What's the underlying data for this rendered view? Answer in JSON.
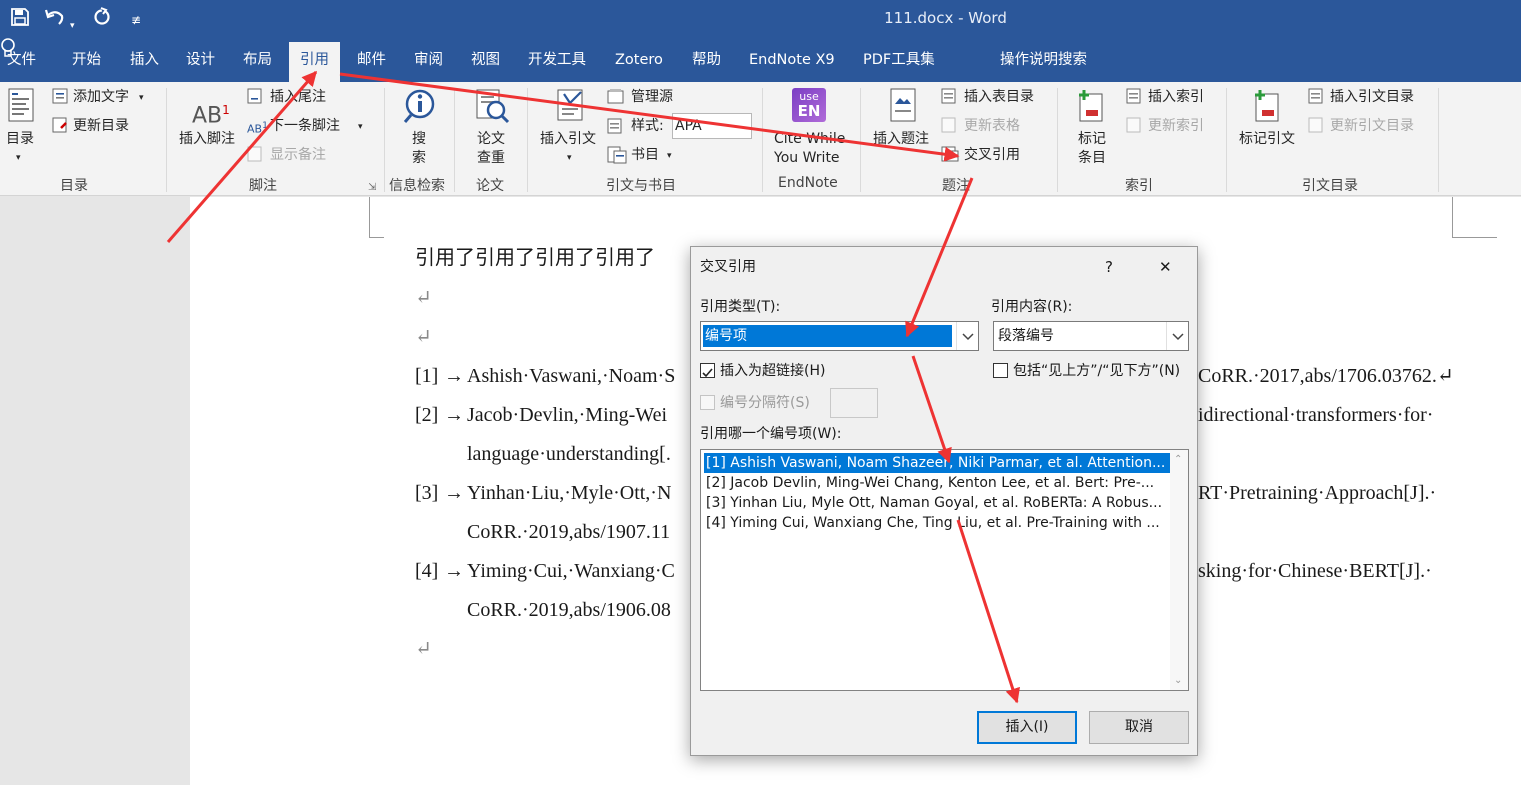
{
  "window": {
    "title": "111.docx  -  Word",
    "accent": "#2b579a",
    "arrow_color": "#ee3333"
  },
  "quick_access": {
    "save_icon": "save-icon",
    "undo_icon": "undo-icon",
    "redo_icon": "redo-icon",
    "customize": "≢"
  },
  "tabs": [
    {
      "label": "文件"
    },
    {
      "label": "开始"
    },
    {
      "label": "插入"
    },
    {
      "label": "设计"
    },
    {
      "label": "布局"
    },
    {
      "label": "引用",
      "active": true
    },
    {
      "label": "邮件"
    },
    {
      "label": "审阅"
    },
    {
      "label": "视图"
    },
    {
      "label": "开发工具"
    },
    {
      "label": "Zotero"
    },
    {
      "label": "帮助"
    },
    {
      "label": "EndNote X9"
    },
    {
      "label": "PDF工具集"
    }
  ],
  "tell_me": "操作说明搜索",
  "ribbon": {
    "toc": {
      "button": "目录",
      "add_text": "添加文字",
      "update": "更新目录",
      "group": "目录"
    },
    "footnotes": {
      "insert_footnote": "插入脚注",
      "insert_endnote": "插入尾注",
      "next_footnote": "下一条脚注",
      "show_notes": "显示备注",
      "group": "脚注",
      "ab_label": "AB",
      "ab_sup": "1"
    },
    "research": {
      "search_line1": "搜",
      "search_line2": "索",
      "group": "信息检索"
    },
    "thesis": {
      "check_line1": "论文",
      "check_line2": "查重",
      "group": "论文"
    },
    "citations": {
      "insert_citation": "插入引文",
      "manage_sources": "管理源",
      "style_label": "样式:",
      "style_value": "APA",
      "bibliography": "书目",
      "group": "引文与书目"
    },
    "endnote": {
      "logo_top": "use",
      "logo_bottom": "EN",
      "cite_line1": "Cite While",
      "cite_line2": "You Write",
      "group": "EndNote"
    },
    "captions": {
      "insert_caption": "插入题注",
      "insert_table_of_figures": "插入表目录",
      "update_table": "更新表格",
      "cross_reference": "交叉引用",
      "group": "题注"
    },
    "index": {
      "mark_entry_line1": "标记",
      "mark_entry_line2": "条目",
      "insert_index": "插入索引",
      "update_index": "更新索引",
      "group": "索引"
    },
    "toa": {
      "mark_citation": "标记引文",
      "insert_toa": "插入引文目录",
      "update_toa": "更新引文目录",
      "group": "引文目录"
    }
  },
  "document": {
    "first_line": "引用了引用了引用了引用了",
    "pilcrow": "↵",
    "refs": [
      {
        "num": "[1]",
        "arrow": "→",
        "left": "Ashish·Vaswani,·Noam·S",
        "right": "CoRR.·2017,abs/1706.03762.↵"
      },
      {
        "num": "[2]",
        "arrow": "→",
        "left": "Jacob·Devlin,·Ming-Wei",
        "right": "idirectional·transformers·for·",
        "cont": "language·understanding[."
      },
      {
        "num": "[3]",
        "arrow": "→",
        "left": "Yinhan·Liu,·Myle·Ott,·N",
        "right": "RT·Pretraining·Approach[J].·",
        "cont": "CoRR.·2019,abs/1907.11"
      },
      {
        "num": "[4]",
        "arrow": "→",
        "left": "Yiming·Cui,·Wanxiang·C",
        "right": "sking·for·Chinese·BERT[J].·",
        "cont": "CoRR.·2019,abs/1906.08"
      }
    ]
  },
  "dialog": {
    "title": "交叉引用",
    "help": "?",
    "close": "✕",
    "ref_type_label": "引用类型(T):",
    "ref_type_value": "编号项",
    "ref_content_label": "引用内容(R):",
    "ref_content_value": "段落编号",
    "insert_hyperlink": "插入为超链接(H)",
    "insert_hyperlink_checked": true,
    "include_above_below": "包括“见上方”/“见下方”(N)",
    "include_above_below_checked": false,
    "separate_numbers": "编号分隔符(S)",
    "for_which_label": "引用哪一个编号项(W):",
    "items": [
      "[1] Ashish Vaswani, Noam Shazeer, Niki Parmar, et al. Attention...",
      "[2] Jacob Devlin, Ming-Wei Chang, Kenton Lee, et al. Bert: Pre-...",
      "[3] Yinhan Liu, Myle Ott, Naman Goyal, et al. RoBERTa: A Robus...",
      "[4] Yiming Cui, Wanxiang Che, Ting Liu, et al. Pre-Training with ..."
    ],
    "selected_index": 0,
    "insert_button": "插入(I)",
    "cancel_button": "取消"
  }
}
